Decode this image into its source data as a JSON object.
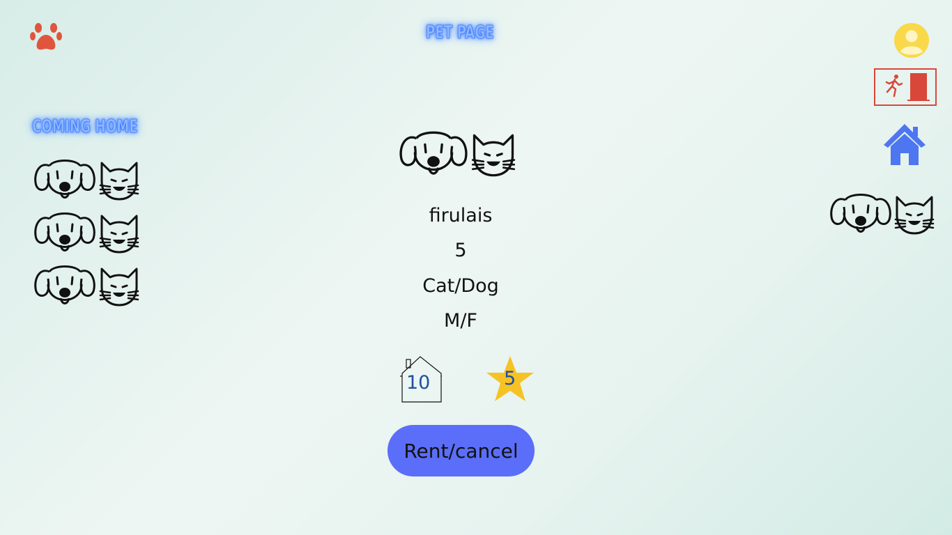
{
  "header": {
    "title": "PET PAGE",
    "logo_icon": "paw-icon",
    "profile_icon": "user-avatar-icon",
    "logout_icon": "exit-door-icon",
    "home_icon": "home-icon"
  },
  "sidebar": {
    "title": "COMING HOME",
    "items": [
      {
        "icon": "dog-cat-icon"
      },
      {
        "icon": "dog-cat-icon"
      },
      {
        "icon": "dog-cat-icon"
      }
    ]
  },
  "pet": {
    "name": "firulais",
    "age": "5",
    "species": "Cat/Dog",
    "sex": "M/F",
    "homes_count": "10",
    "rating": "5"
  },
  "actions": {
    "rent_label": "Rent/cancel"
  },
  "colors": {
    "accent": "#5b6ef9",
    "paw": "#e0553c",
    "avatar": "#f9d94a",
    "exit": "#d9473a",
    "home": "#4e76f0",
    "star": "#f6c224",
    "neon": "#8fb8ff"
  }
}
